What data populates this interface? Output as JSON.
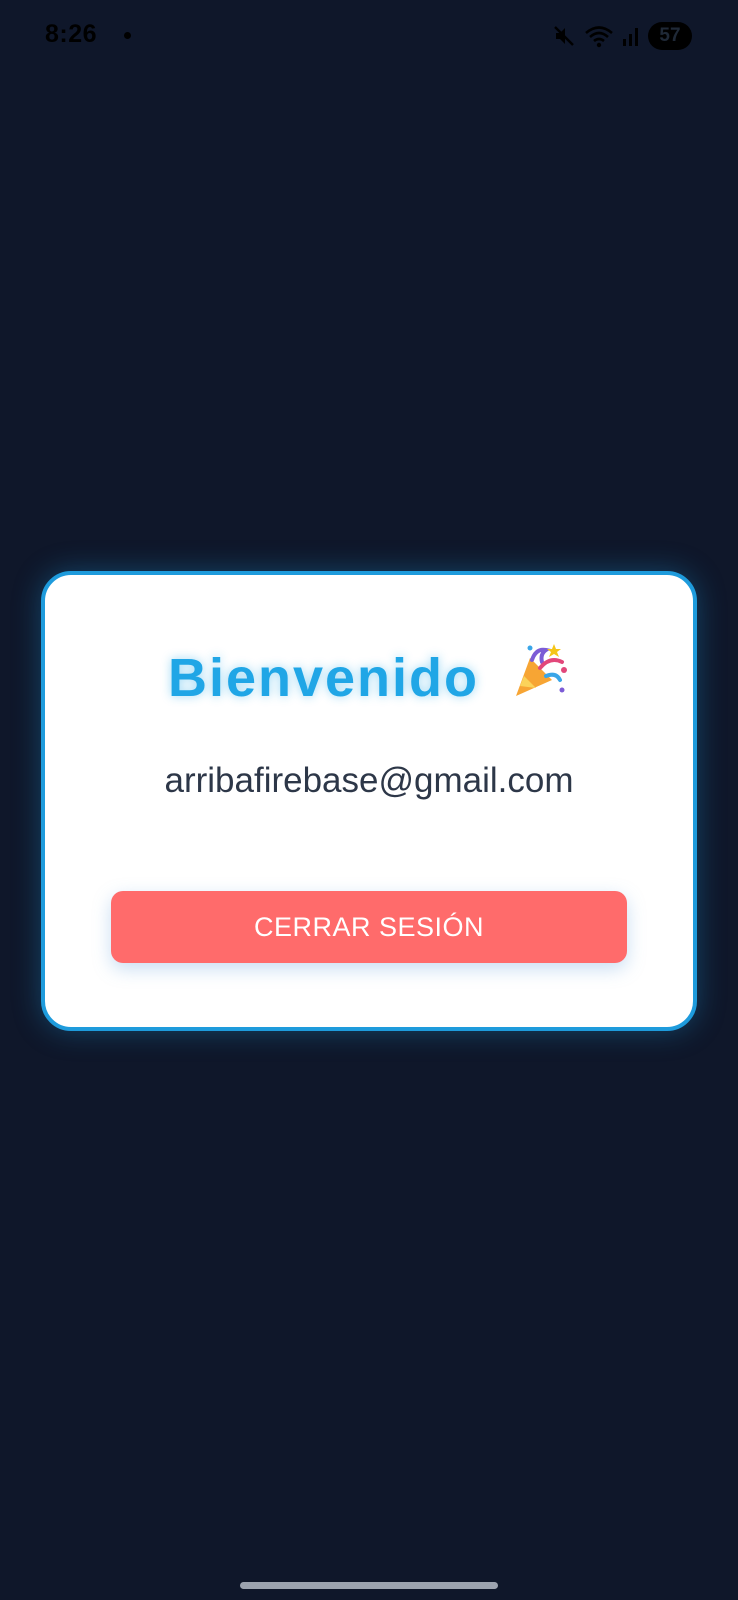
{
  "status_bar": {
    "time": "8:26",
    "battery": "57",
    "icons": [
      "notification-dot-icon",
      "mute-icon",
      "wifi-icon",
      "signal-icon",
      "battery-icon"
    ]
  },
  "card": {
    "title": "Bienvenido",
    "title_emoji": "party-popper-icon",
    "email": "arribafirebase@gmail.com",
    "logout_label": "CERRAR SESIÓN"
  },
  "colors": {
    "background": "#0f172a",
    "card_border": "#1e9bdc",
    "title": "#20a6e6",
    "logout_button": "#ff6b6b"
  }
}
